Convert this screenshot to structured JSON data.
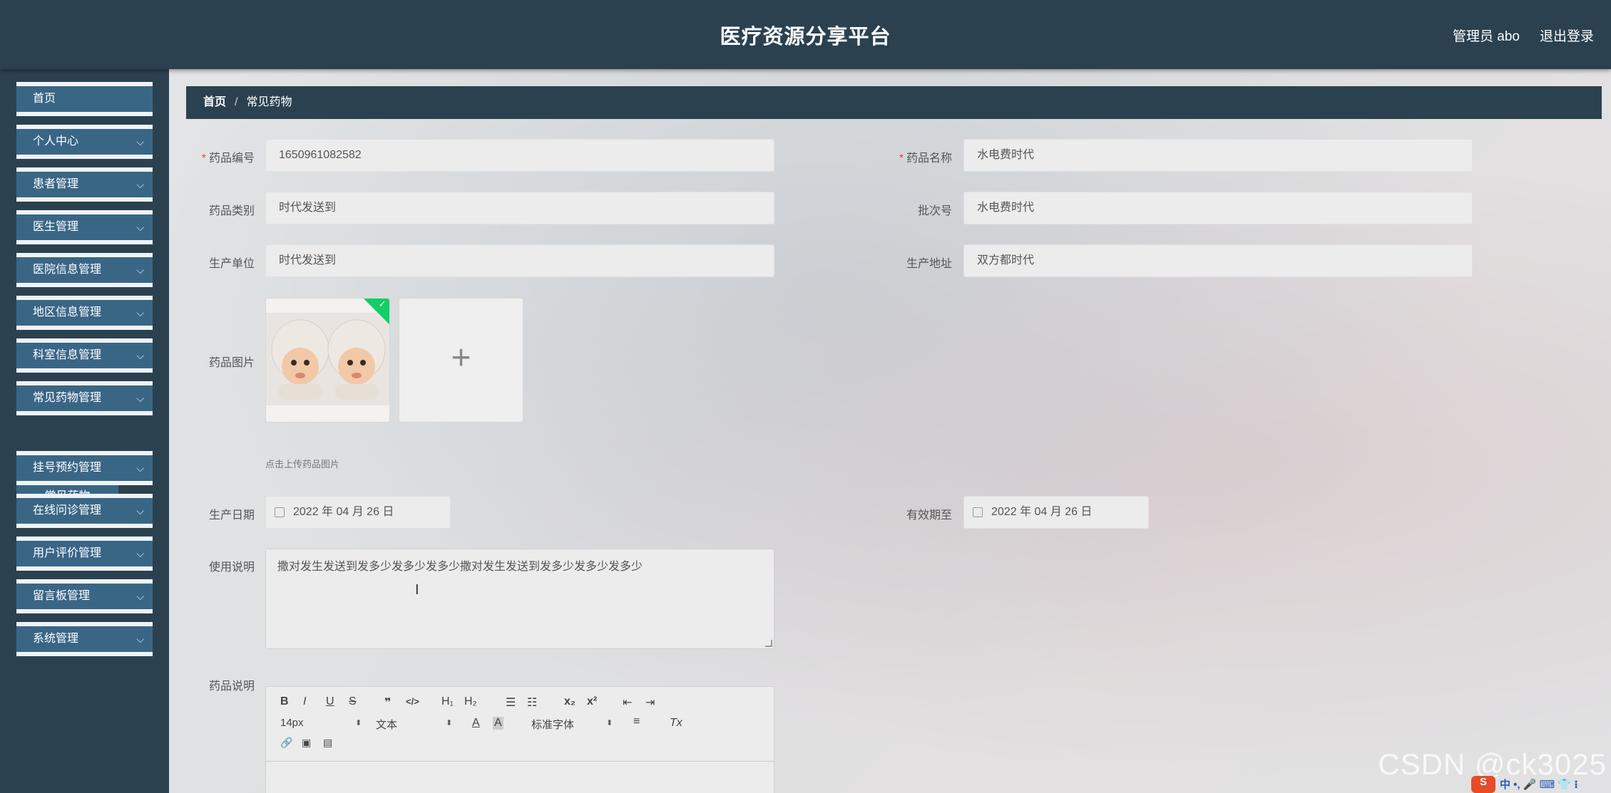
{
  "header": {
    "title": "医疗资源分享平台",
    "user": "管理员 abo",
    "logout": "退出登录"
  },
  "sidebar": {
    "items": [
      {
        "label": "首页",
        "expandable": false
      },
      {
        "label": "个人中心",
        "expandable": true
      },
      {
        "label": "患者管理",
        "expandable": true
      },
      {
        "label": "医生管理",
        "expandable": true
      },
      {
        "label": "医院信息管理",
        "expandable": true
      },
      {
        "label": "地区信息管理",
        "expandable": true
      },
      {
        "label": "科室信息管理",
        "expandable": true
      },
      {
        "label": "常见药物管理",
        "expandable": true
      },
      {
        "label": "挂号预约管理",
        "expandable": true
      },
      {
        "label": "在线问诊管理",
        "expandable": true
      },
      {
        "label": "用户评价管理",
        "expandable": true
      },
      {
        "label": "留言板管理",
        "expandable": true
      },
      {
        "label": "系统管理",
        "expandable": true
      }
    ],
    "subitem": "常见药物",
    "chevron": "⌵"
  },
  "breadcrumb": {
    "home": "首页",
    "separator": "/",
    "current": "常见药物"
  },
  "form": {
    "code_label": "药品编号",
    "code_value": "1650961082582",
    "name_label": "药品名称",
    "name_value": "水电费时代",
    "category_label": "药品类别",
    "category_value": "时代发送到",
    "batch_label": "批次号",
    "batch_value": "水电费时代",
    "maker_label": "生产单位",
    "maker_value": "时代发送到",
    "address_label": "生产地址",
    "address_value": "双方都时代",
    "image_label": "药品图片",
    "image_hint": "点击上传药品图片",
    "add_symbol": "+",
    "prod_date_label": "生产日期",
    "prod_date_value": "2022 年 04 月 26 日",
    "expiry_label": "有效期至",
    "expiry_value": "2022 年 04 月 26 日",
    "usage_label": "使用说明",
    "usage_value": "撒对发生发送到发多少发多少发多少撒对发生发送到发多少发多少发多少",
    "desc_label": "药品说明",
    "required_mark": "*"
  },
  "editor": {
    "buttons": [
      "B",
      "I",
      "U",
      "S",
      "❞",
      "</>",
      "H₁",
      "H₂",
      "☰",
      "☷",
      "x₂",
      "x²",
      "⇤",
      "⇥"
    ],
    "font_size": "14px",
    "text_style": "文本",
    "font_family": "标准字体",
    "color_btn": "A",
    "bg_btn": "A",
    "align_btn": "≡",
    "clear_btn": "Tx",
    "row3": [
      "🔗",
      "▣",
      "▤"
    ]
  },
  "watermark": "CSDN @ck3025",
  "tray": {
    "logo": "S",
    "text": "中 •, 🎤 ⌨ 👕 ⁝"
  }
}
